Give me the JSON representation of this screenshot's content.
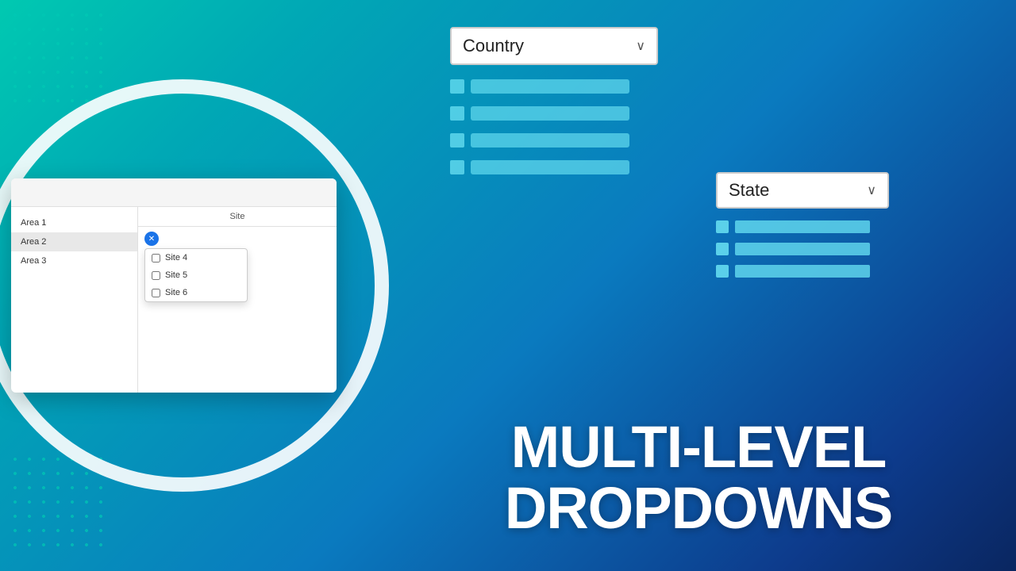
{
  "background": {
    "gradient_start": "#00c9b1",
    "gradient_end": "#0a2660"
  },
  "country_dropdown": {
    "label": "Country",
    "chevron": "∨"
  },
  "state_dropdown": {
    "label": "State",
    "chevron": "∨"
  },
  "preview": {
    "site_column_header": "Site",
    "areas": [
      {
        "label": "Area 1",
        "active": false
      },
      {
        "label": "Area 2",
        "active": true
      },
      {
        "label": "Area 3",
        "active": false
      }
    ],
    "dropdown_items": [
      {
        "label": "Site 4"
      },
      {
        "label": "Site 5"
      },
      {
        "label": "Site 6"
      }
    ]
  },
  "title_line1": "MULTI-LEVEL",
  "title_line2": "DROPDOWNS"
}
